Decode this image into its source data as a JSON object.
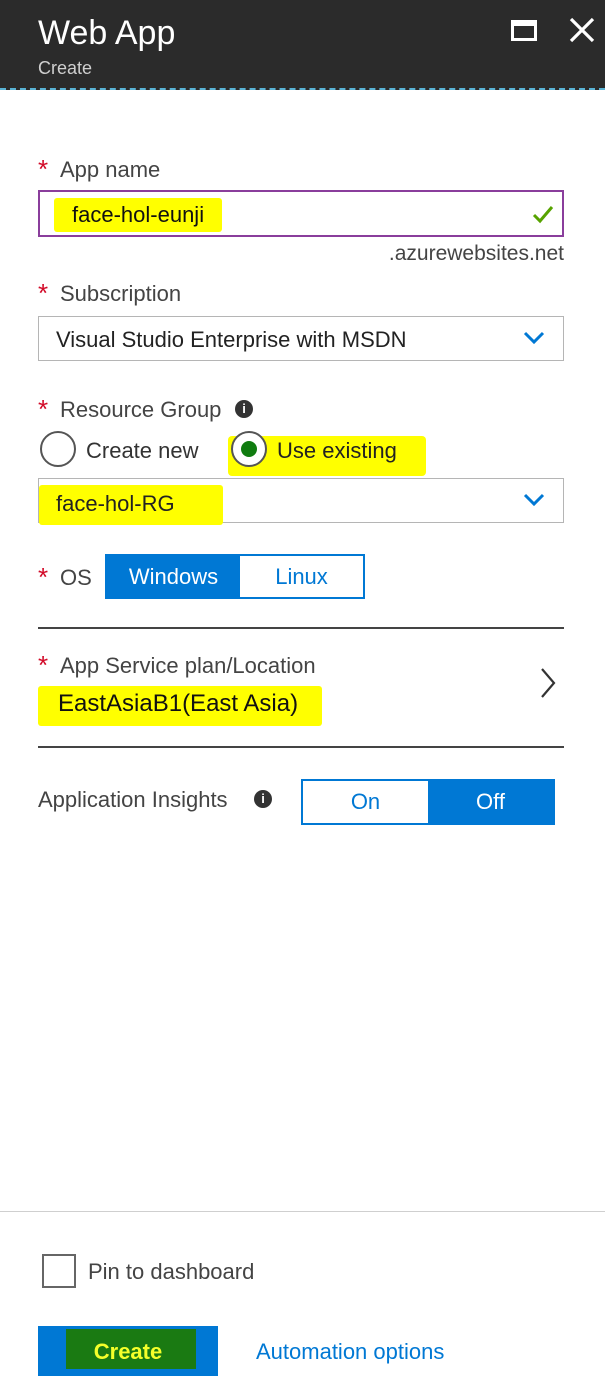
{
  "header": {
    "title": "Web App",
    "subtitle": "Create"
  },
  "app_name": {
    "label": "App name",
    "value": "face-hol-eunji",
    "suffix": ".azurewebsites.net"
  },
  "subscription": {
    "label": "Subscription",
    "value": "Visual Studio Enterprise with MSDN"
  },
  "resource_group": {
    "label": "Resource Group",
    "options": {
      "create_new": "Create new",
      "use_existing": "Use existing"
    },
    "selected": "use_existing",
    "value": "face-hol-RG"
  },
  "os": {
    "label": "OS",
    "options": [
      "Windows",
      "Linux"
    ],
    "selected": "Windows"
  },
  "app_service_plan": {
    "label": "App Service plan/Location",
    "value": "EastAsiaB1(East Asia)"
  },
  "app_insights": {
    "label": "Application Insights",
    "options": [
      "On",
      "Off"
    ],
    "selected": "Off"
  },
  "footer": {
    "pin_label": "Pin to dashboard",
    "pin_checked": false,
    "create_label": "Create",
    "automation_label": "Automation options"
  },
  "colors": {
    "accent": "#0078d4",
    "highlight": "#ffff00",
    "required": "#d20a28",
    "header_bg": "#2b2b2b"
  }
}
